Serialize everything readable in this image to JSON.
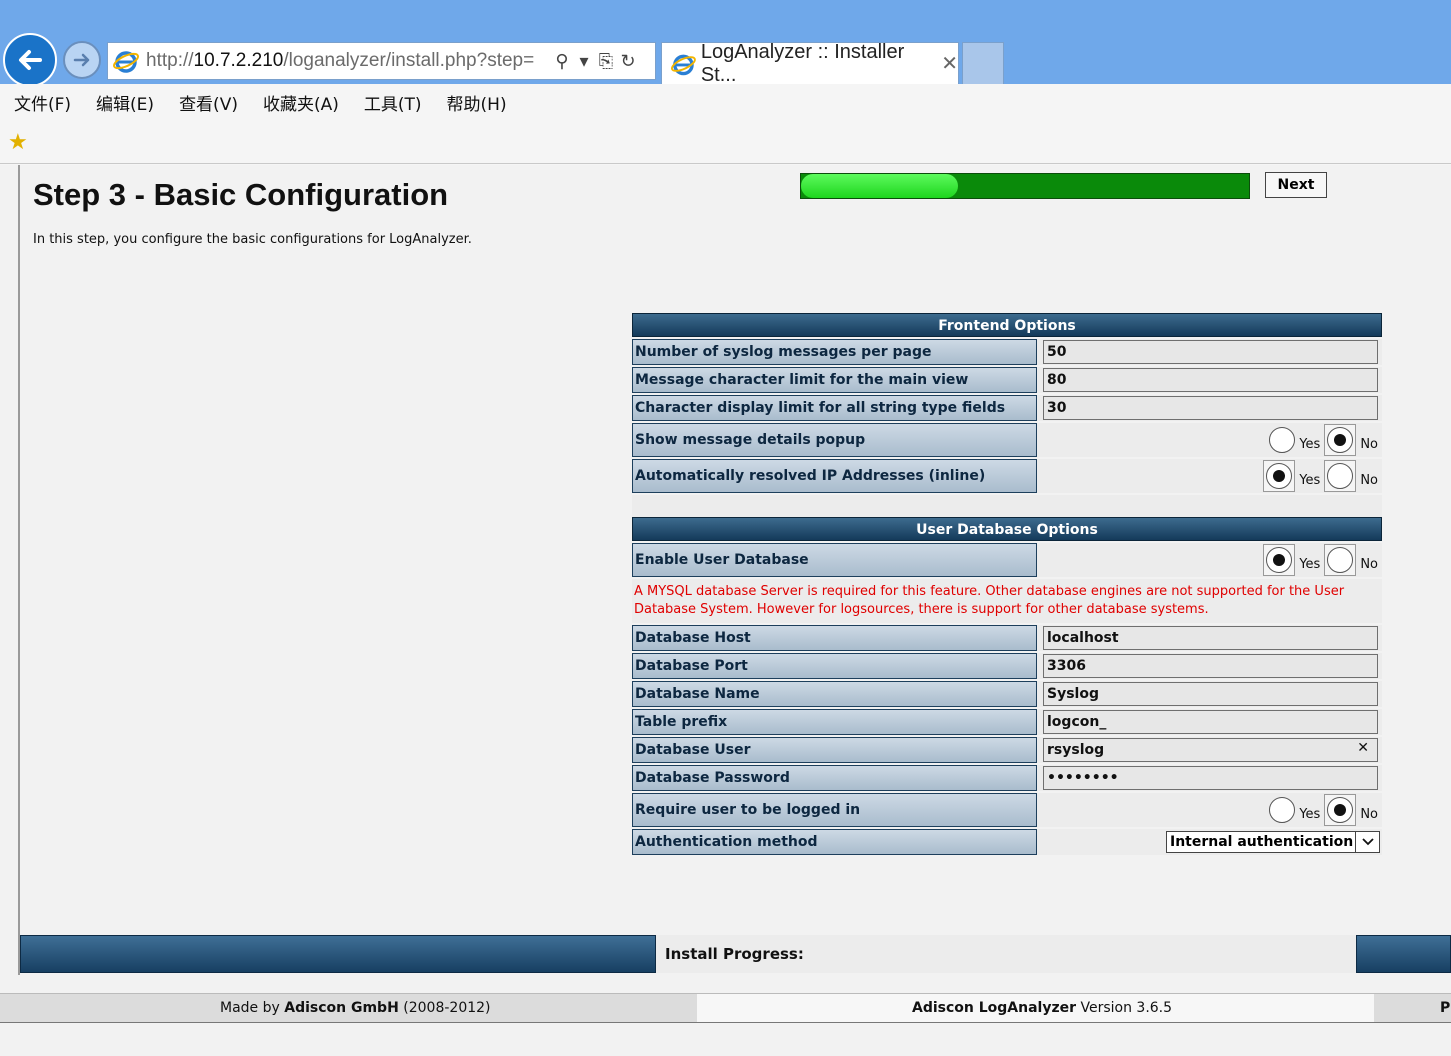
{
  "browser": {
    "url_prefix": "http://",
    "url_host": "10.7.2.210",
    "url_path": "/loganalyzer/install.php?step=",
    "tab_title": "LogAnalyzer :: Installer St...",
    "menu": [
      "文件(F)",
      "编辑(E)",
      "查看(V)",
      "收藏夹(A)",
      "工具(T)",
      "帮助(H)"
    ]
  },
  "page": {
    "title": "Step 3 - Basic Configuration",
    "description": "In this step, you configure the basic configurations for LogAnalyzer."
  },
  "frontend": {
    "header": "Frontend Options",
    "rows": [
      {
        "label": "Number of syslog messages per page",
        "value": "50"
      },
      {
        "label": "Message character limit for the main view",
        "value": "80"
      },
      {
        "label": "Character display limit for all string type fields",
        "value": "30"
      }
    ],
    "popup": {
      "label": "Show message details popup",
      "selected": "No"
    },
    "resolve": {
      "label": "Automatically resolved IP Addresses (inline)",
      "selected": "Yes"
    }
  },
  "userdb": {
    "header": "User Database Options",
    "enable": {
      "label": "Enable User Database",
      "selected": "Yes"
    },
    "warning": "A MYSQL database Server is required for this feature. Other database engines are not supported for the User Database System. However for logsources, there is support for other database systems.",
    "rows": [
      {
        "label": "Database Host",
        "value": "localhost"
      },
      {
        "label": "Database Port",
        "value": "3306"
      },
      {
        "label": "Database Name",
        "value": "Syslog"
      },
      {
        "label": "Table prefix",
        "value": "logcon_"
      },
      {
        "label": "Database User",
        "value": "rsyslog"
      },
      {
        "label": "Database Password",
        "value": "••••••••"
      }
    ],
    "require_login": {
      "label": "Require user to be logged in",
      "selected": "No"
    },
    "auth": {
      "label": "Authentication method",
      "value": "Internal authentication"
    }
  },
  "radio_labels": {
    "yes": "Yes",
    "no": "No"
  },
  "progress": {
    "label": "Install Progress:",
    "fraction": 0.35,
    "next": "Next"
  },
  "footer": {
    "made_by_prefix": "Made by ",
    "company": "Adiscon GmbH",
    "years": " (2008-2012)",
    "product": "Adiscon LogAnalyzer",
    "version": " Version 3.6.5",
    "edge": "P"
  }
}
